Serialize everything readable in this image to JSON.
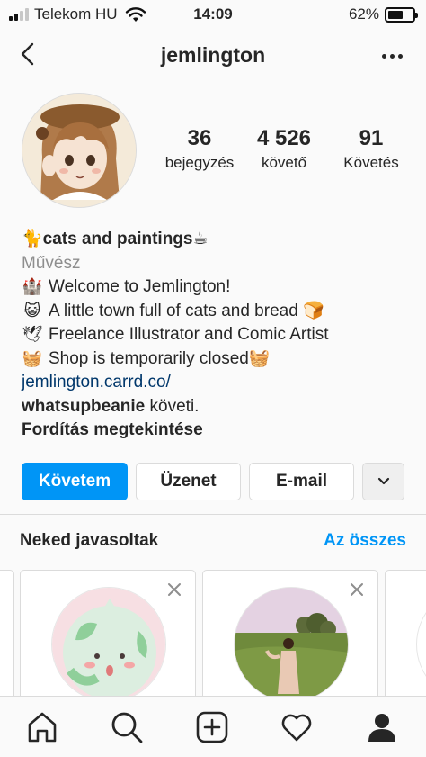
{
  "status_bar": {
    "carrier": "Telekom HU",
    "time": "14:09",
    "battery": "62%",
    "battery_level": 0.62,
    "signal_bars": 2,
    "icons": [
      "signal-icon",
      "wifi-icon",
      "battery-icon"
    ]
  },
  "header": {
    "username": "jemlington",
    "back_icon": "chevron-left-icon",
    "more_icon": "more-icon"
  },
  "profile": {
    "avatar_icon": "avatar",
    "stats": [
      {
        "value": "36",
        "label": "bejegyzés"
      },
      {
        "value": "4 526",
        "label": "követő"
      },
      {
        "value": "91",
        "label": "Követés"
      }
    ]
  },
  "bio": {
    "name_prefix_emoji": "🐈",
    "name": "cats and paintings",
    "name_suffix_emoji": "☕",
    "category": "Művész",
    "lines": [
      {
        "emoji": "🏰",
        "text": "Welcome to Jemlington!"
      },
      {
        "emoji": "😺",
        "text": "A little town full of cats and bread 🍞"
      },
      {
        "emoji": "🕊",
        "text": "Freelance Illustrator and Comic Artist"
      },
      {
        "emoji": "🧺",
        "text": "Shop is temporarily closed🧺"
      }
    ],
    "link": "jemlington.carrd.co/",
    "followed_by_user": "whatsupbeanie",
    "followed_by_suffix": " követi.",
    "translate": "Fordítás megtekintése"
  },
  "actions": {
    "follow": "Követem",
    "message": "Üzenet",
    "email": "E-mail",
    "dropdown_icon": "chevron-down-icon"
  },
  "suggestions": {
    "title": "Neked javasoltak",
    "see_all": "Az összes",
    "cards": [
      {
        "pic": "ghost-illustration-avatar",
        "close_icon": "close-icon"
      },
      {
        "pic": "field-photo-avatar",
        "close_icon": "close-icon"
      }
    ]
  },
  "tabbar": {
    "items": [
      "home-icon",
      "search-icon",
      "add-icon",
      "heart-icon",
      "profile-icon"
    ]
  },
  "colors": {
    "accent_blue": "#0095f6",
    "link_blue": "#00376b",
    "text": "#262626",
    "muted": "#8e8e8e",
    "border": "#dbdbdb"
  }
}
